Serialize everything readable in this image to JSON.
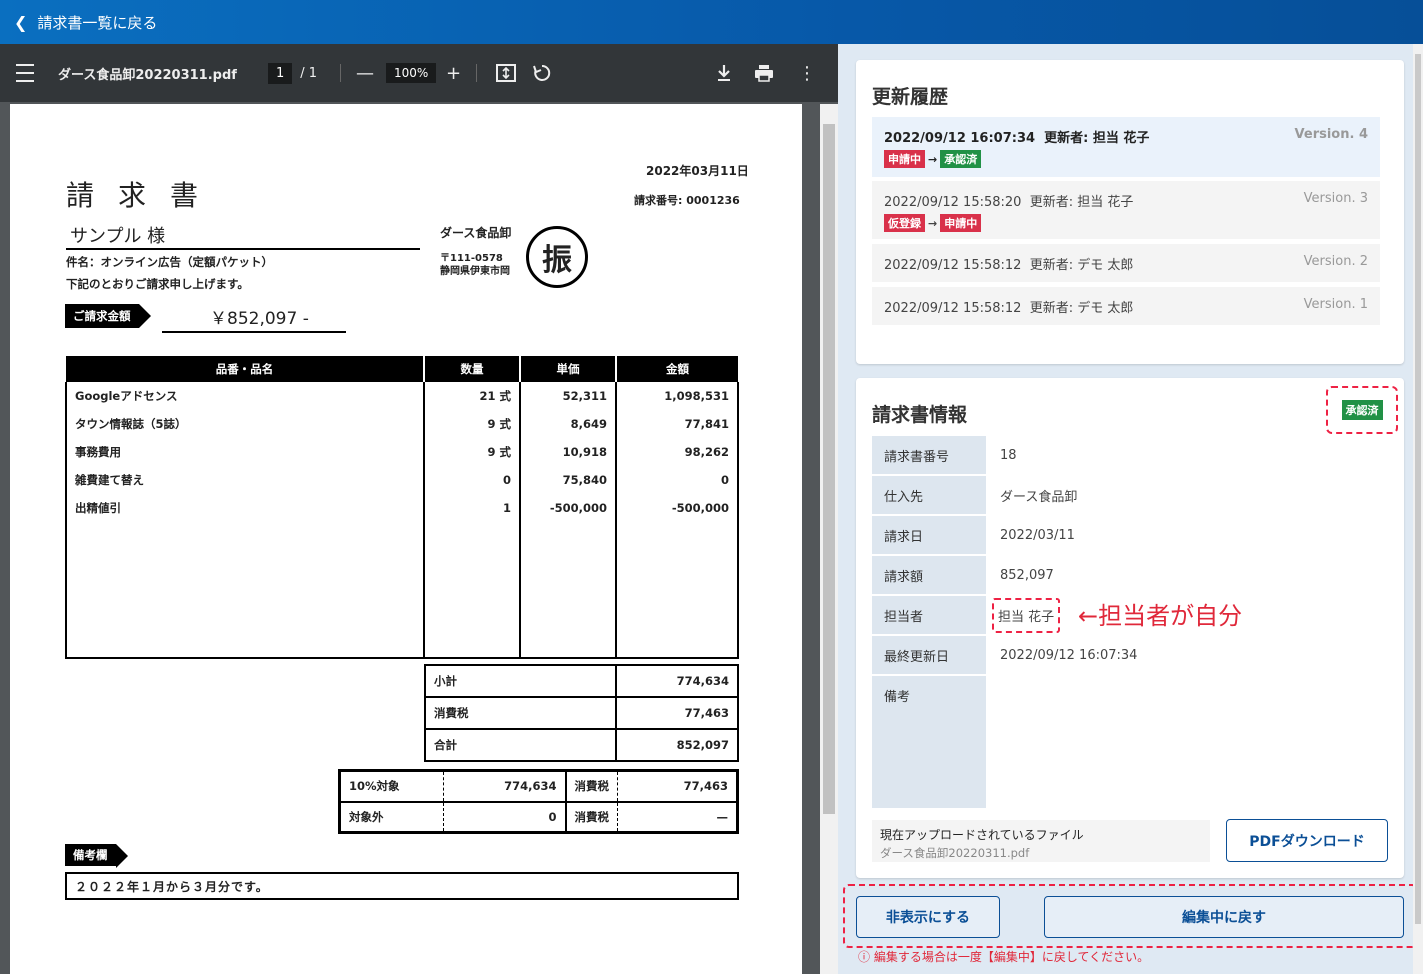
{
  "topbar": {
    "back_label": "請求書一覧に戻る"
  },
  "viewer": {
    "file_name": "ダース食品卸20220311.pdf",
    "page_current": "1",
    "page_total": "/  1",
    "zoom": "100%"
  },
  "invoice": {
    "date": "2022年03月11日",
    "title": "請求書",
    "number": "請求番号: 0001236",
    "to": "サンプル 様",
    "subject": "件名：オンライン広告（定額パケット）",
    "note": "下記のとおりご請求申し上げます。",
    "seller": "ダース食品卸",
    "zip": "〒111-0578",
    "address": "静岡県伊東市岡",
    "stamp": "振",
    "amount_label": "ご請求金額",
    "amount": "￥852,097 -",
    "columns": [
      "品番・品名",
      "数量",
      "単価",
      "金額"
    ],
    "rows": [
      [
        "Googleアドセンス",
        "21 式",
        "52,311",
        "1,098,531"
      ],
      [
        "タウン情報誌（5誌）",
        "9 式",
        "8,649",
        "77,841"
      ],
      [
        "事務費用",
        "9 式",
        "10,918",
        "98,262"
      ],
      [
        "雑費建て替え",
        "0",
        "75,840",
        "0"
      ],
      [
        "出精値引",
        "1",
        "-500,000",
        "-500,000"
      ]
    ],
    "subtotal_label": "小計",
    "subtotal": "774,634",
    "tax_label": "消費税",
    "tax": "77,463",
    "total_label": "合計",
    "total": "852,097",
    "tax10_label": "10%対象",
    "tax10_base": "774,634",
    "tax10_tax_label": "消費税",
    "tax10_tax": "77,463",
    "exempt_label": "対象外",
    "exempt_base": "0",
    "exempt_tax_label": "消費税",
    "exempt_tax": "—",
    "remarks_label": "備考欄",
    "remarks": "２０２２年１月から３月分です。"
  },
  "history": {
    "title": "更新履歴",
    "items": [
      {
        "time": "2022/09/12  16:07:34",
        "editor": "更新者: 担当 花子",
        "version": "Version. 4",
        "from": "申請中",
        "to": "承認済"
      },
      {
        "time": "2022/09/12  15:58:20",
        "editor": "更新者: 担当 花子",
        "version": "Version. 3",
        "from": "仮登録",
        "to": "申請中"
      },
      {
        "time": "2022/09/12  15:58:12",
        "editor": "更新者: デモ 太郎",
        "version": "Version. 2"
      },
      {
        "time": "2022/09/12  15:58:12",
        "editor": "更新者: デモ 太郎",
        "version": "Version. 1"
      }
    ]
  },
  "info": {
    "title": "請求書情報",
    "status": "承認済",
    "fields": [
      {
        "label": "請求書番号",
        "value": "18"
      },
      {
        "label": "仕入先",
        "value": "ダース食品卸"
      },
      {
        "label": "請求日",
        "value": "2022/03/11"
      },
      {
        "label": "請求額",
        "value": "852,097"
      },
      {
        "label": "担当者",
        "value": "担当 花子"
      },
      {
        "label": "最終更新日",
        "value": "2022/09/12 16:07:34"
      },
      {
        "label": "備考",
        "value": ""
      }
    ],
    "annotation": "←担当者が自分",
    "file_label": "現在アップロードされているファイル",
    "file_name": "ダース食品卸20220311.pdf",
    "pdf_button": "PDFダウンロード"
  },
  "actions": {
    "hide": "非表示にする",
    "revert": "編集中に戻す",
    "warning": "ⓘ 編集する場合は一度【編集中】に戻してください。"
  },
  "colors": {
    "topbar": "#0758a8",
    "accent": "#0b4f96",
    "red": "#d9314a",
    "green": "#219146"
  }
}
